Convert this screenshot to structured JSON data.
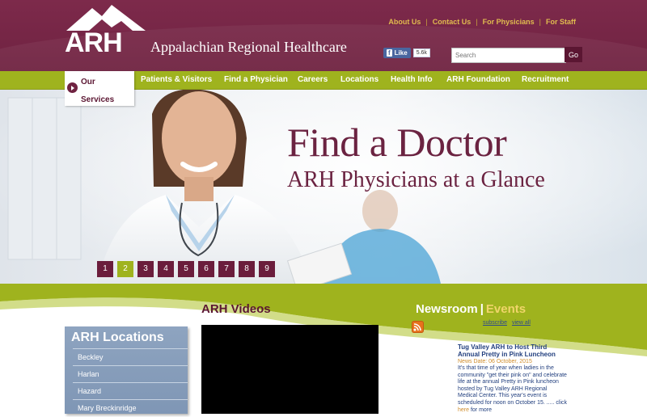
{
  "header": {
    "logo_text": "ARH",
    "org_name": "Appalachian Regional Healthcare",
    "top_links": [
      "About Us",
      "Contact Us",
      "For Physicians",
      "For Staff"
    ],
    "fb_like_label": "Like",
    "fb_count": "5.6k",
    "search_placeholder": "Search",
    "search_button": "Go"
  },
  "nav": {
    "active": "Our Services",
    "items": [
      "Patients & Visitors",
      "Find a Physician",
      "Careers",
      "Locations",
      "Health Info",
      "ARH Foundation",
      "Recruitment"
    ]
  },
  "hero": {
    "title": "Find a Doctor",
    "subtitle": "ARH Physicians at a Glance",
    "pages": [
      "1",
      "2",
      "3",
      "4",
      "5",
      "6",
      "7",
      "8",
      "9"
    ],
    "active_page": "2"
  },
  "locations": {
    "title": "ARH Locations",
    "items": [
      "Beckley",
      "Harlan",
      "Hazard",
      "Mary Breckinridge"
    ]
  },
  "videos": {
    "title": "ARH Videos"
  },
  "newsroom": {
    "title": "Newsroom",
    "separator": "|",
    "events": "Events",
    "subscribe": "subscribe",
    "view_all": "view all",
    "article": {
      "title": "Tug Valley ARH to Host Third Annual Pretty in Pink Luncheon",
      "date": "News Date: 06 October, 2015",
      "body": "It's that time of year when ladies in the community \"get their pink on\" and celebrate life at the annual Pretty in Pink luncheon hosted by Tug Valley ARH Regional Medical Center. This year's event is scheduled for noon on October 15. ..... click",
      "link": "here",
      "tail": "for more"
    }
  },
  "colors": {
    "maroon": "#6f2241",
    "green": "#9fb31e",
    "gold": "#e0bb4f",
    "location_blue": "#8ea4c0"
  }
}
